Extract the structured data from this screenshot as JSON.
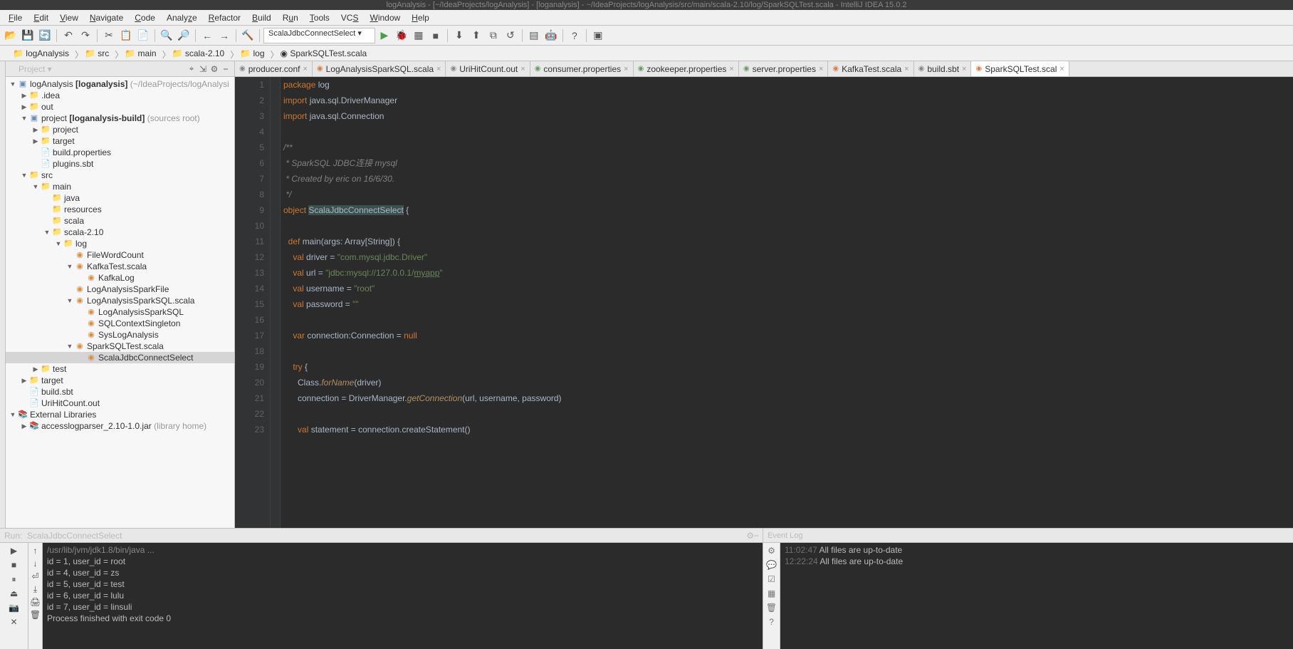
{
  "title": "logAnalysis - [~/IdeaProjects/logAnalysis] - [loganalysis] - ~/IdeaProjects/logAnalysis/src/main/scala-2.10/log/SparkSQLTest.scala - IntelliJ IDEA 15.0.2",
  "menu": [
    "File",
    "Edit",
    "View",
    "Navigate",
    "Code",
    "Analyze",
    "Refactor",
    "Build",
    "Run",
    "Tools",
    "VCS",
    "Window",
    "Help"
  ],
  "run_config": "ScalaJdbcConnectSelect ▾",
  "breadcrumb": [
    "logAnalysis",
    "src",
    "main",
    "scala-2.10",
    "log",
    "SparkSQLTest.scala"
  ],
  "project_header": "Project ▾",
  "tree": {
    "root": "logAnalysis",
    "root_bold": "[loganalysis]",
    "root_hint": "(~/IdeaProjects/logAnalysi",
    "idea": ".idea",
    "out": "out",
    "project": "project",
    "project_bold": "[loganalysis-build]",
    "project_hint": "(sources root)",
    "project_sub": "project",
    "target1": "target",
    "buildprops": "build.properties",
    "pluginssbt": "plugins.sbt",
    "src": "src",
    "main": "main",
    "java": "java",
    "resources": "resources",
    "scala": "scala",
    "scala210": "scala-2.10",
    "log": "log",
    "fwc": "FileWordCount",
    "kts": "KafkaTest.scala",
    "kl": "KafkaLog",
    "lasf": "LogAnalysisSparkFile",
    "lass": "LogAnalysisSparkSQL.scala",
    "lass2": "LogAnalysisSparkSQL",
    "sqlcs": "SQLContextSingleton",
    "sla": "SysLogAnalysis",
    "sst": "SparkSQLTest.scala",
    "sjcs": "ScalaJdbcConnectSelect",
    "test": "test",
    "target2": "target",
    "buildsbt": "build.sbt",
    "uhc": "UriHitCount.out",
    "extlib": "External Libraries",
    "alp": "accesslogparser_2.10-1.0.jar",
    "alp_hint": "(library home)"
  },
  "tabs": [
    {
      "icon": "ti-conf",
      "label": "producer.conf",
      "active": false
    },
    {
      "icon": "ti-scala",
      "label": "LogAnalysisSparkSQL.scala",
      "active": false
    },
    {
      "icon": "ti-txt",
      "label": "UriHitCount.out",
      "active": false
    },
    {
      "icon": "ti-prop",
      "label": "consumer.properties",
      "active": false
    },
    {
      "icon": "ti-prop",
      "label": "zookeeper.properties",
      "active": false
    },
    {
      "icon": "ti-prop",
      "label": "server.properties",
      "active": false
    },
    {
      "icon": "ti-scala",
      "label": "KafkaTest.scala",
      "active": false
    },
    {
      "icon": "ti-txt",
      "label": "build.sbt",
      "active": false
    },
    {
      "icon": "ti-scala",
      "label": "SparkSQLTest.scal",
      "active": true
    }
  ],
  "code_lines": [
    [
      [
        "kw",
        "package "
      ],
      [
        "cls",
        "log"
      ]
    ],
    [
      [
        "kw",
        "import "
      ],
      [
        "cls",
        "java.sql.DriverManager"
      ]
    ],
    [
      [
        "kw",
        "import "
      ],
      [
        "cls",
        "java.sql.Connection"
      ]
    ],
    [
      [
        "",
        ""
      ]
    ],
    [
      [
        "cmt",
        "/**"
      ]
    ],
    [
      [
        "cmt",
        " * SparkSQL JDBC连接 mysql"
      ]
    ],
    [
      [
        "cmt",
        " * Created by eric on 16/6/30."
      ]
    ],
    [
      [
        "cmt",
        " */"
      ]
    ],
    [
      [
        "kw",
        "object "
      ],
      [
        "hl",
        "ScalaJdbcConnectSelect"
      ],
      [
        "",
        " {"
      ]
    ],
    [
      [
        "",
        ""
      ]
    ],
    [
      [
        "",
        "  "
      ],
      [
        "kw",
        "def "
      ],
      [
        "cls",
        "main"
      ],
      [
        "",
        "(args: Array["
      ],
      [
        "cls",
        "String"
      ],
      [
        "",
        "]) {"
      ]
    ],
    [
      [
        "",
        "    "
      ],
      [
        "kw",
        "val "
      ],
      [
        "cls",
        "driver"
      ],
      [
        "",
        " = "
      ],
      [
        "str",
        "\"com.mysql.jdbc.Driver\""
      ]
    ],
    [
      [
        "",
        "    "
      ],
      [
        "kw",
        "val "
      ],
      [
        "cls",
        "url"
      ],
      [
        "",
        " = "
      ],
      [
        "str",
        "\"jdbc:mysql://127.0.0.1/"
      ],
      [
        "str ul",
        "myapp"
      ],
      [
        "str",
        "\""
      ]
    ],
    [
      [
        "",
        "    "
      ],
      [
        "kw",
        "val "
      ],
      [
        "cls",
        "username"
      ],
      [
        "",
        " = "
      ],
      [
        "str",
        "\"root\""
      ]
    ],
    [
      [
        "",
        "    "
      ],
      [
        "kw",
        "val "
      ],
      [
        "cls",
        "password"
      ],
      [
        "",
        " = "
      ],
      [
        "str",
        "\"\""
      ]
    ],
    [
      [
        "",
        ""
      ]
    ],
    [
      [
        "",
        "    "
      ],
      [
        "kw",
        "var "
      ],
      [
        "cls",
        "connection"
      ],
      [
        "",
        ":Connection = "
      ],
      [
        "kw",
        "null"
      ]
    ],
    [
      [
        "",
        ""
      ]
    ],
    [
      [
        "",
        "    "
      ],
      [
        "kw",
        "try"
      ],
      [
        "",
        " {"
      ]
    ],
    [
      [
        "",
        "      Class."
      ],
      [
        "fn-it",
        "forName"
      ],
      [
        "",
        "(driver)"
      ]
    ],
    [
      [
        "",
        "      connection = DriverManager."
      ],
      [
        "fn-it",
        "getConnection"
      ],
      [
        "",
        "(url, username, password)"
      ]
    ],
    [
      [
        "",
        ""
      ]
    ],
    [
      [
        "",
        "      "
      ],
      [
        "kw",
        "val "
      ],
      [
        "cls",
        "statement"
      ],
      [
        "",
        " = connection.createStatement()"
      ]
    ]
  ],
  "run_header": "Run:",
  "run_tab": "ScalaJdbcConnectSelect",
  "console_lines": [
    "/usr/lib/jvm/jdk1.8/bin/java ...",
    "id = 1, user_id = root",
    "id = 4, user_id = zs",
    "id = 5, user_id = test",
    "id = 6, user_id = lulu",
    "id = 7, user_id = linsuli",
    "",
    "Process finished with exit code 0"
  ],
  "event_header": "Event Log",
  "event_lines": [
    {
      "ts": "11:02:47",
      "msg": " All files are up-to-date"
    },
    {
      "ts": "12:22:24",
      "msg": " All files are up-to-date"
    }
  ]
}
